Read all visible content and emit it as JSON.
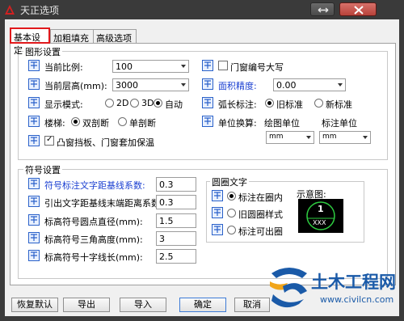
{
  "window": {
    "title": "天正选项"
  },
  "tabs": [
    {
      "label": "基本设定"
    },
    {
      "label": "加粗填充"
    },
    {
      "label": "高级选项"
    }
  ],
  "graphics_group": {
    "label": "图形设置",
    "scale_label": "当前比例:",
    "scale_value": "100",
    "floor_label": "当前层高(mm):",
    "floor_value": "3000",
    "display_label": "显示模式:",
    "display_options": [
      "2D",
      "3D",
      "自动"
    ],
    "display_selected": "自动",
    "stair_label": "楼梯:",
    "stair_options": [
      "双剖断",
      "单剖断"
    ],
    "stair_selected": "双剖断",
    "window_seal_label": "凸窗挡板、门窗套加保温",
    "window_seal_checked": true,
    "door_upper_label": "门窗编号大写",
    "door_upper_checked": false,
    "area_precision_label": "面积精度:",
    "area_precision_value": "0.00",
    "arc_label": "弧长标注:",
    "arc_options": [
      "旧标准",
      "新标准"
    ],
    "arc_selected": "旧标准",
    "unit_label": "单位换算:",
    "drawing_unit_label": "绘图单位",
    "annotation_unit_label": "标注单位",
    "drawing_unit_value": "mm",
    "annotation_unit_value": "mm"
  },
  "symbol_group": {
    "label": "符号设置",
    "rows": [
      {
        "label": "符号标注文字距基线系数:",
        "value": "0.3",
        "blue": true
      },
      {
        "label": "引出文字距基线末端距离系数:",
        "value": "0.3",
        "blue": false
      },
      {
        "label": "标高符号圆点直径(mm):",
        "value": "1.5",
        "blue": false
      },
      {
        "label": "标高符号三角高度(mm):",
        "value": "3",
        "blue": false
      },
      {
        "label": "标高符号十字线长(mm):",
        "value": "2.5",
        "blue": false
      }
    ]
  },
  "circle_text_group": {
    "label": "圆圈文字",
    "options": [
      "标注在圈内",
      "旧圆圈样式",
      "标注可出圈"
    ],
    "selected": "标注在圈内",
    "preview_label": "示意图:",
    "preview_number": "1",
    "preview_text": "XXX"
  },
  "buttons": {
    "restore_default": "恢复默认",
    "export": "导出",
    "import": "导入",
    "ok": "确定",
    "cancel": "取消"
  },
  "watermark": {
    "title": "土木工程网",
    "url": "www.civilcn.com"
  },
  "colors": {
    "accent_red": "#e0191c",
    "blue_label": "#1a3fd1",
    "icon_blue": "#2a61c9",
    "preview_green": "#2ecc40"
  }
}
